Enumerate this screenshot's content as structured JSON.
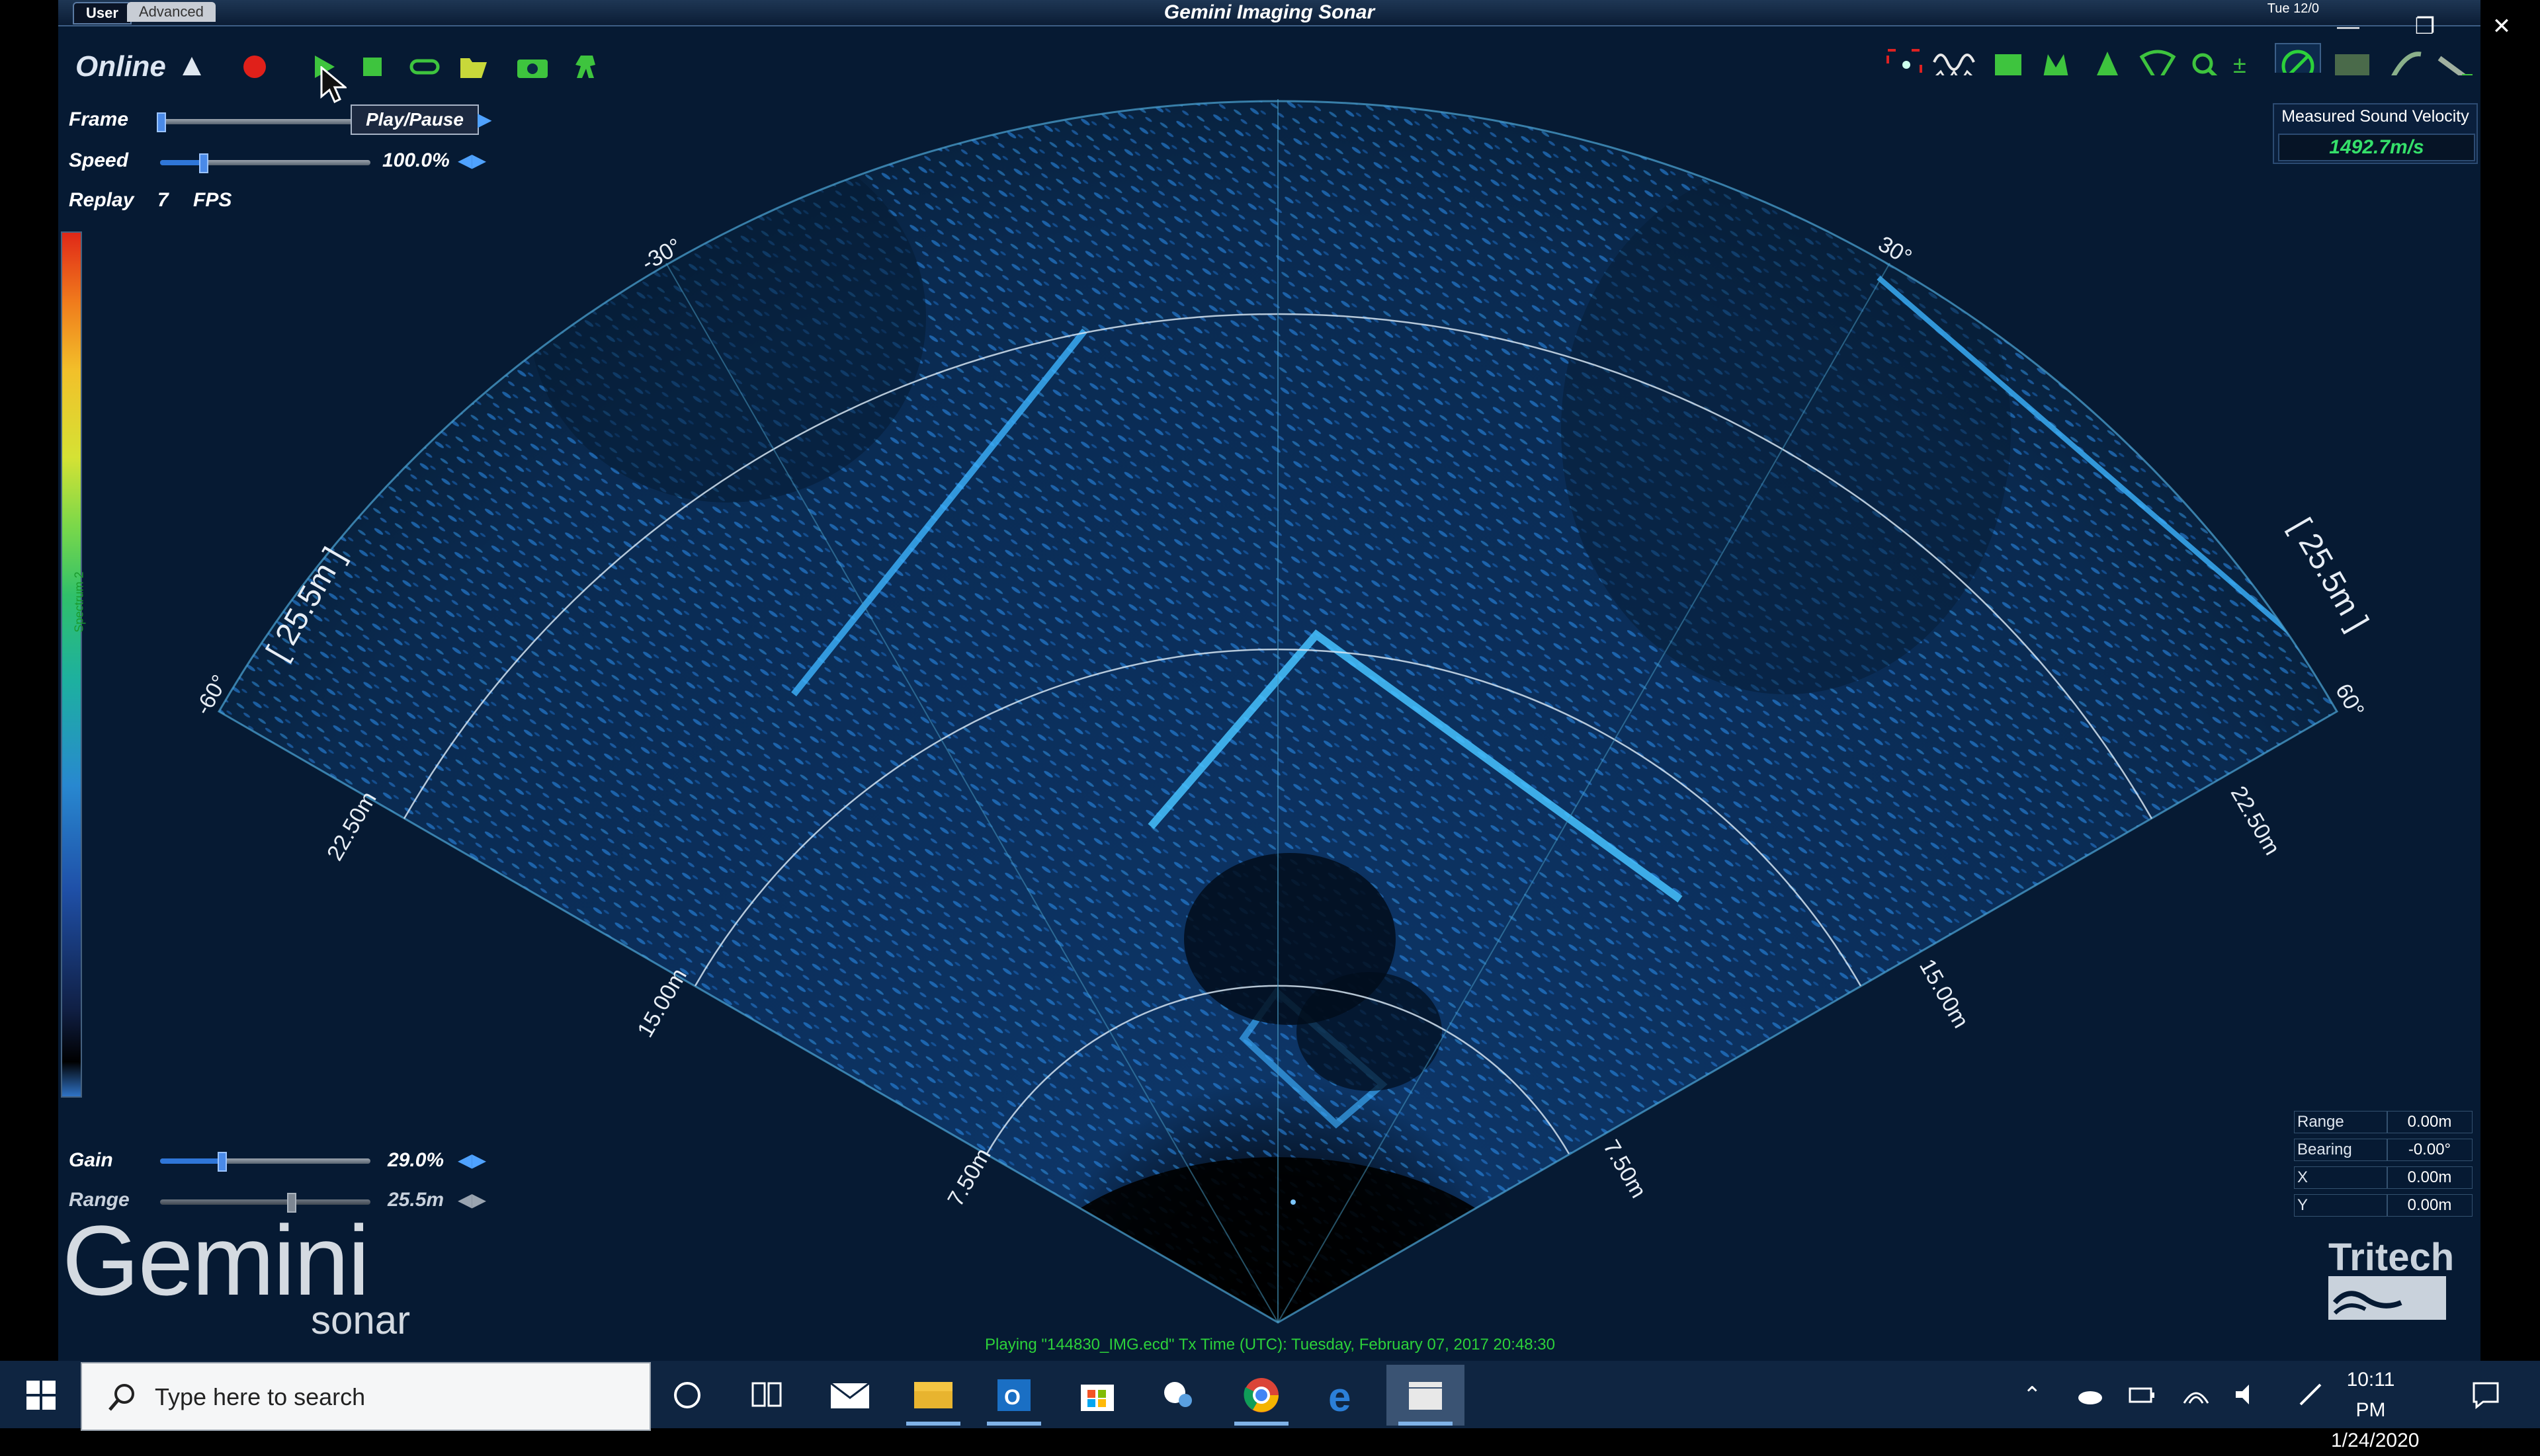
{
  "window": {
    "title": "Gemini Imaging Sonar",
    "mode_tabs": [
      "User",
      "Advanced"
    ],
    "date_fragment": "Tue 12/0"
  },
  "toolbar": {
    "online_label": "Online",
    "left_icons": [
      "sonar-icon",
      "record-icon",
      "play-icon",
      "stop-icon",
      "loop-icon",
      "open-folder-icon",
      "snapshot-icon",
      "video-record-icon"
    ],
    "right_icons": [
      "zoom-fit-icon",
      "waveform-icon",
      "map-icon",
      "layers-icon",
      "tree-icon",
      "wifi-fan-icon",
      "magnifier-icon",
      "plus-minus-icon",
      "circle-mode-icon",
      "image-icon",
      "feather-icon",
      "tool-icon"
    ],
    "tooltip": "Play/Pause"
  },
  "controls": {
    "frame_label": "Frame",
    "frame_position": 0.0,
    "speed_label": "Speed",
    "speed_value": "100.0%",
    "speed_position": 0.2,
    "replay_label": "Replay",
    "replay_value": "7",
    "replay_unit": "FPS",
    "gain_label": "Gain",
    "gain_value": "29.0%",
    "gain_position": 0.29,
    "range_label": "Range",
    "range_value": "25.5m",
    "range_position": 0.62
  },
  "colorbar": {
    "label": "Spectrum 2"
  },
  "sonar": {
    "bearing_labels": [
      "-60°",
      "-30°",
      "30°",
      "60°"
    ],
    "range_labels": [
      "7.50m",
      "15.00m",
      "22.50m"
    ],
    "max_range_label": "[ 25.5m ]",
    "colors": {
      "beam": "#2ea8ff",
      "ring": "#cfe2f2",
      "fan_bg": "#0a2a4d"
    }
  },
  "sound_velocity": {
    "title": "Measured Sound Velocity",
    "value": "1492.7m/s",
    "color": "#35e06a"
  },
  "readout": [
    {
      "key": "Range",
      "value": "0.00m"
    },
    {
      "key": "Bearing",
      "value": "-0.00°"
    },
    {
      "key": "X",
      "value": "0.00m"
    },
    {
      "key": "Y",
      "value": "0.00m"
    }
  ],
  "status": "Playing \"144830_IMG.ecd\" Tx Time (UTC): Tuesday, February 07, 2017 20:48:30",
  "branding": {
    "gemini": "Gemini",
    "sonar": "sonar",
    "tritech": "Tritech"
  },
  "taskbar": {
    "search_placeholder": "Type here to search",
    "pinned": [
      "cortana-icon",
      "task-view-icon",
      "mail-icon",
      "file-explorer-icon",
      "outlook-icon",
      "store-icon",
      "snipping-icon",
      "chrome-icon",
      "edge-icon",
      "clapper-icon"
    ],
    "time": "10:11 PM",
    "date": "1/24/2020"
  }
}
